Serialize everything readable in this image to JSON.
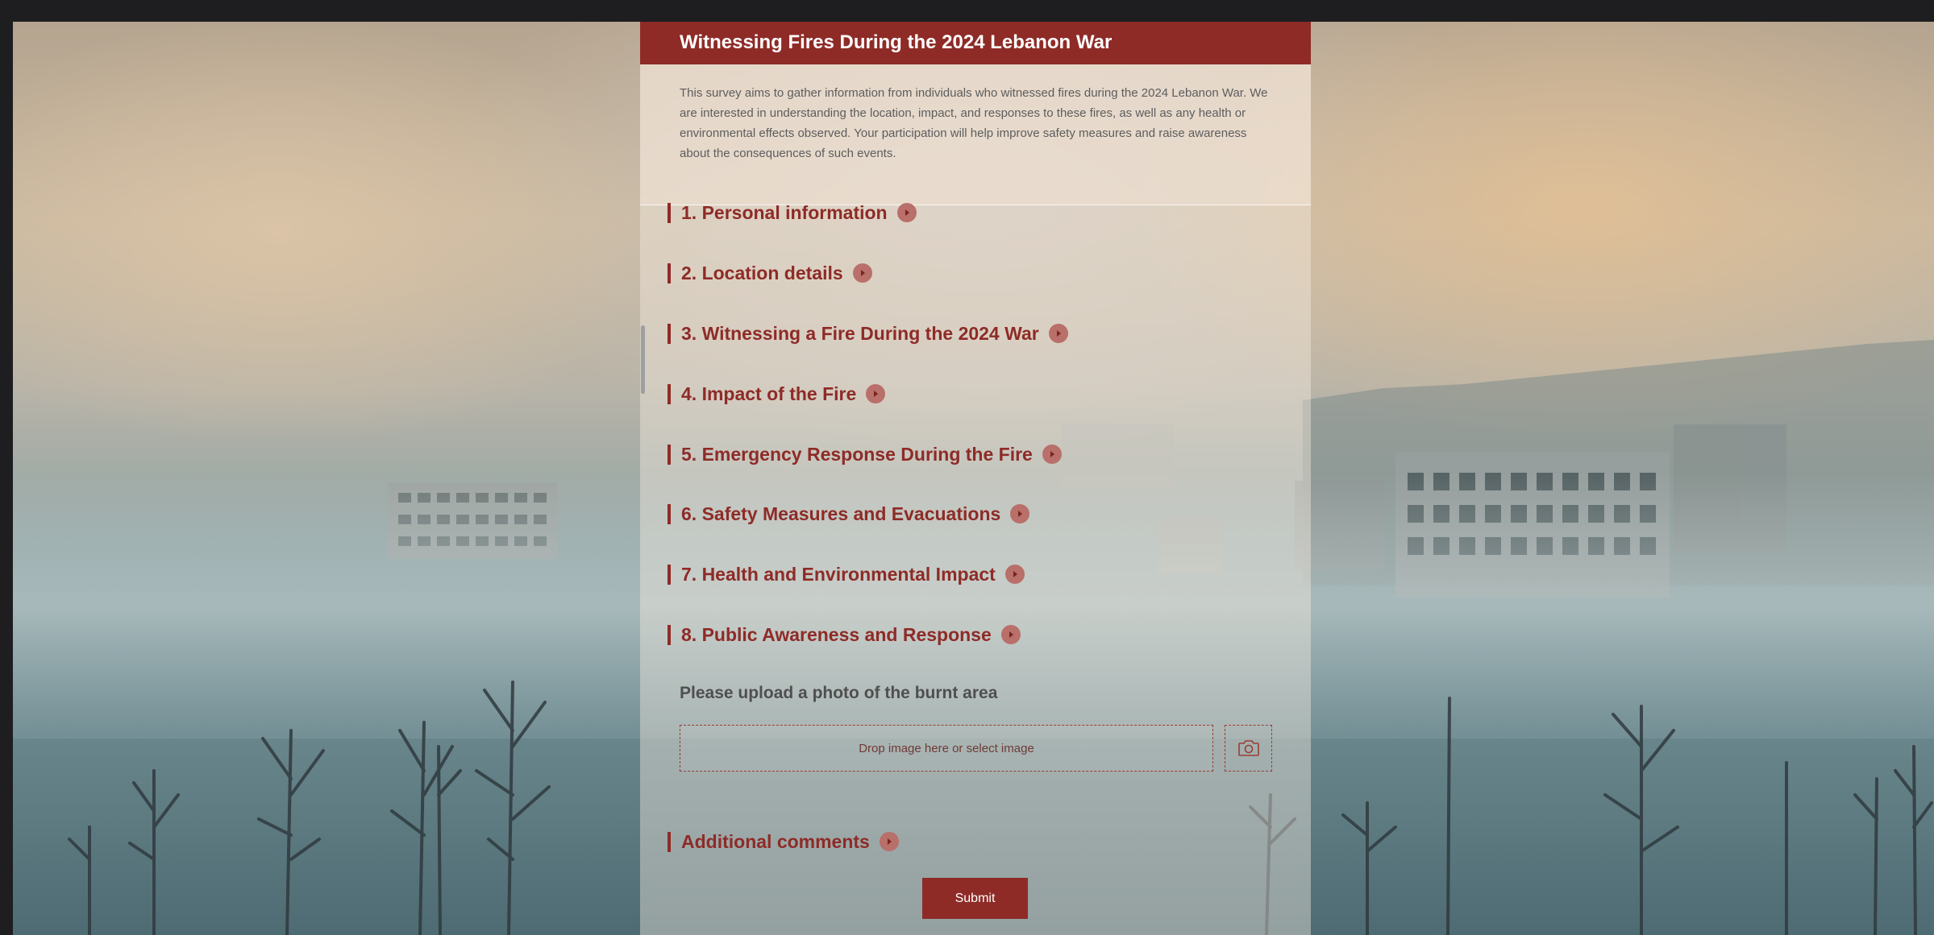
{
  "form": {
    "title": "Witnessing Fires During the 2024 Lebanon War",
    "description": "This survey aims to gather information from individuals who witnessed fires during the 2024 Lebanon War. We are interested in understanding the location, impact, and responses to these fires, as well as any health or environmental effects observed. Your participation will help improve safety measures and raise awareness about the consequences of such events.",
    "sections": [
      {
        "label": "1. Personal information"
      },
      {
        "label": "2. Location details"
      },
      {
        "label": "3. Witnessing a Fire During the 2024 War"
      },
      {
        "label": "4. Impact of the Fire"
      },
      {
        "label": "5. Emergency Response During the Fire"
      },
      {
        "label": "6. Safety Measures and Evacuations"
      },
      {
        "label": "7. Health and Environmental Impact"
      },
      {
        "label": "8. Public Awareness and Response"
      }
    ],
    "upload": {
      "label": "Please upload a photo of the burnt area",
      "drop_text": "Drop image here or select image",
      "camera_icon": "camera-icon"
    },
    "additional": {
      "label": "Additional comments"
    },
    "submit_label": "Submit",
    "section_arrow_icon": "chevron-right-icon"
  },
  "colors": {
    "accent": "#8e2b27",
    "arrow_badge": "#b96f6a",
    "frame": "#1e1e21"
  }
}
